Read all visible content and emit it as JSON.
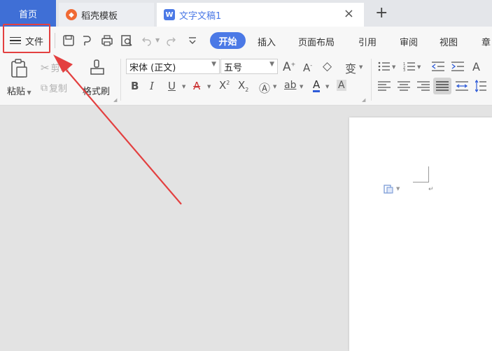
{
  "tabs": {
    "home": "首页",
    "template": "稻壳模板",
    "doc": "文字文稿1",
    "close": "×",
    "new": "+"
  },
  "menu": {
    "file": "文件",
    "items": [
      "开始",
      "插入",
      "页面布局",
      "引用",
      "审阅",
      "视图"
    ]
  },
  "clipboard": {
    "paste": "粘贴",
    "cut": "剪切",
    "copy": "复制",
    "format_painter": "格式刷"
  },
  "font": {
    "name": "宋体 (正文)",
    "size": "五号"
  },
  "colors": {
    "accent": "#4b79e6",
    "home_tab": "#3f6fd6",
    "annotation": "#e34040"
  },
  "icons": [
    "menu-icon",
    "save-icon",
    "undo-icon",
    "print-icon",
    "print-preview-icon",
    "redo-icon",
    "more-icon",
    "paste-icon",
    "cut-icon",
    "copy-icon",
    "format-painter-icon",
    "bold-icon",
    "italic-icon",
    "underline-icon",
    "strikethrough-icon",
    "superscript-icon",
    "subscript-icon",
    "text-effect-icon",
    "highlight-icon",
    "font-color-icon",
    "char-shading-icon",
    "grow-font-icon",
    "shrink-font-icon",
    "clear-format-icon",
    "phonetic-icon",
    "bullets-icon",
    "numbering-icon",
    "indent-icon",
    "outdent-icon",
    "align-left-icon",
    "align-center-icon",
    "align-right-icon",
    "justify-icon",
    "distributed-icon",
    "line-spacing-icon",
    "paste-options-icon"
  ]
}
